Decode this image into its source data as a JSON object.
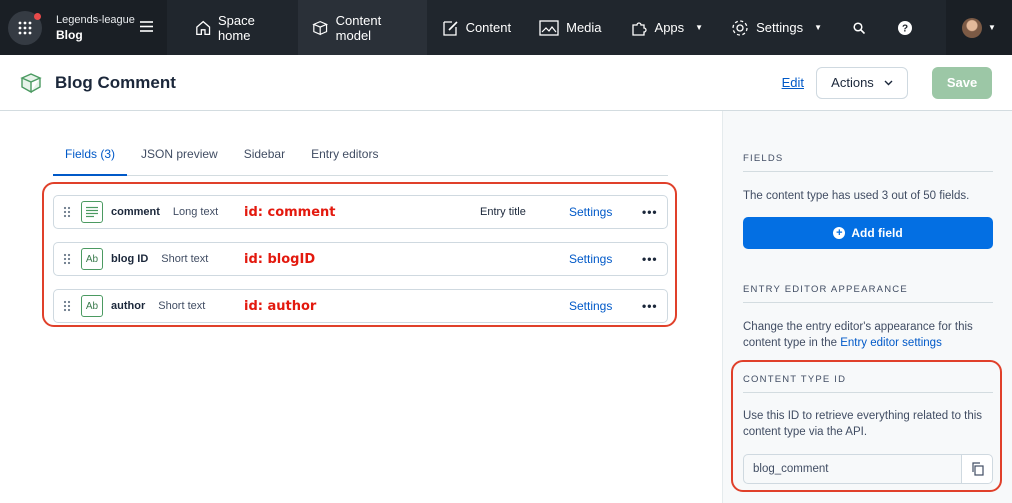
{
  "topbar": {
    "org_name": "Legends-league",
    "space_name": "Blog",
    "nav": [
      {
        "label": "Space home",
        "icon": "house-icon"
      },
      {
        "label": "Content model",
        "icon": "box-icon"
      },
      {
        "label": "Content",
        "icon": "edit-icon"
      },
      {
        "label": "Media",
        "icon": "image-icon"
      },
      {
        "label": "Apps",
        "icon": "puzzle-icon"
      },
      {
        "label": "Settings",
        "icon": "gear-icon"
      }
    ]
  },
  "header": {
    "title": "Blog Comment",
    "edit_label": "Edit",
    "actions_label": "Actions",
    "save_label": "Save"
  },
  "tabs": [
    "Fields (3)",
    "JSON preview",
    "Sidebar",
    "Entry editors"
  ],
  "fields": [
    {
      "name": "comment",
      "type": "Long text",
      "id_note": "id: comment",
      "flag": "Entry title",
      "settings": "Settings",
      "icon": "long-text-icon"
    },
    {
      "name": "blog ID",
      "type": "Short text",
      "id_note": "id: blogID",
      "flag": "",
      "settings": "Settings",
      "icon": "short-text-icon"
    },
    {
      "name": "author",
      "type": "Short text",
      "id_note": "id: author",
      "flag": "",
      "settings": "Settings",
      "icon": "short-text-icon"
    }
  ],
  "field_icon_text": "Ab",
  "more_label": "•••",
  "sidebar": {
    "fields_heading": "FIELDS",
    "fields_text": "The content type has used 3 out of 50 fields.",
    "add_field_label": "Add field",
    "appearance_heading": "ENTRY EDITOR APPEARANCE",
    "appearance_text": "Change the entry editor's appearance for this content type in the",
    "appearance_link": "Entry editor settings",
    "id_heading": "CONTENT TYPE ID",
    "id_text": "Use this ID to retrieve everything related to this content type via the API.",
    "id_value": "blog_comment"
  },
  "colors": {
    "nav_bg": "#20262d",
    "accent_blue": "#0059c8",
    "primary_button": "#036fe3",
    "save_disabled": "#9cc7a6",
    "annotation_red": "#e3190e",
    "field_icon_green": "#4b9a61"
  }
}
